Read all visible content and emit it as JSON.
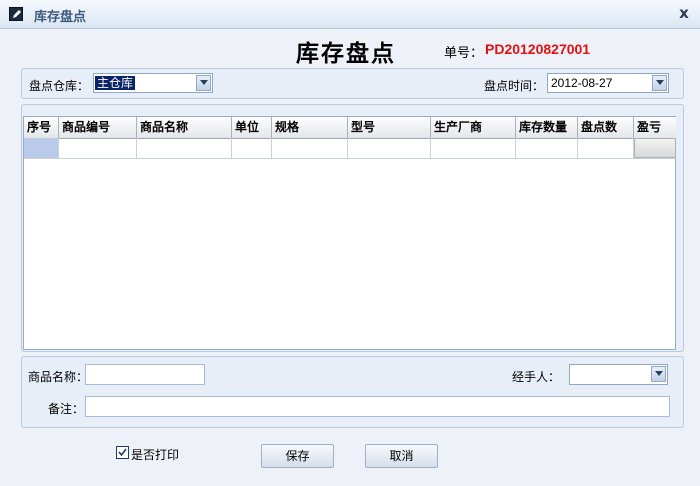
{
  "window": {
    "title": "库存盘点",
    "close": "x"
  },
  "header": {
    "title": "库存盘点",
    "order_label": "单号：",
    "order_no": "PD20120827001"
  },
  "filters": {
    "warehouse_label": "盘点仓库：",
    "warehouse_value": "主仓库",
    "time_label": "盘点时间：",
    "time_value": "2012-08-27"
  },
  "table": {
    "columns": [
      "序号",
      "商品编号",
      "商品名称",
      "单位",
      "规格",
      "型号",
      "生产厂商",
      "库存数量",
      "盘点数",
      "盈亏"
    ]
  },
  "form": {
    "product_name_label": "商品名称：",
    "product_name_value": "",
    "handler_label": "经手人：",
    "handler_value": "",
    "remark_label": "备注：",
    "remark_value": ""
  },
  "footer": {
    "print_label": "是否打印",
    "print_checked": true,
    "save_label": "保存",
    "cancel_label": "取消"
  },
  "colors": {
    "order_no": "#e01010",
    "title_bar": "#dbe6f3"
  }
}
